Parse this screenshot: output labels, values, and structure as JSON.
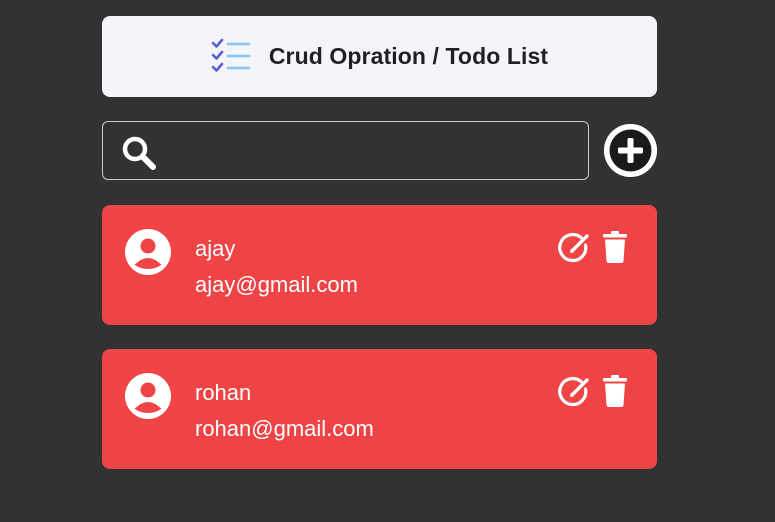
{
  "header": {
    "title": "Crud Opration / Todo List",
    "icon": "todo-list-icon"
  },
  "search": {
    "value": "",
    "placeholder": "",
    "icon": "search-icon"
  },
  "add_button": {
    "icon": "plus-circle-icon"
  },
  "colors": {
    "background": "#313234",
    "header_bg": "#f4f5f9",
    "card_bg": "#ef4446",
    "accent_blue": "#5b5fd1",
    "accent_light_blue": "#8fc6ef"
  },
  "users": [
    {
      "name": "ajay",
      "email": "ajay@gmail.com"
    },
    {
      "name": "rohan",
      "email": "rohan@gmail.com"
    }
  ],
  "card_actions": {
    "edit_icon": "edit-icon",
    "delete_icon": "trash-icon"
  }
}
